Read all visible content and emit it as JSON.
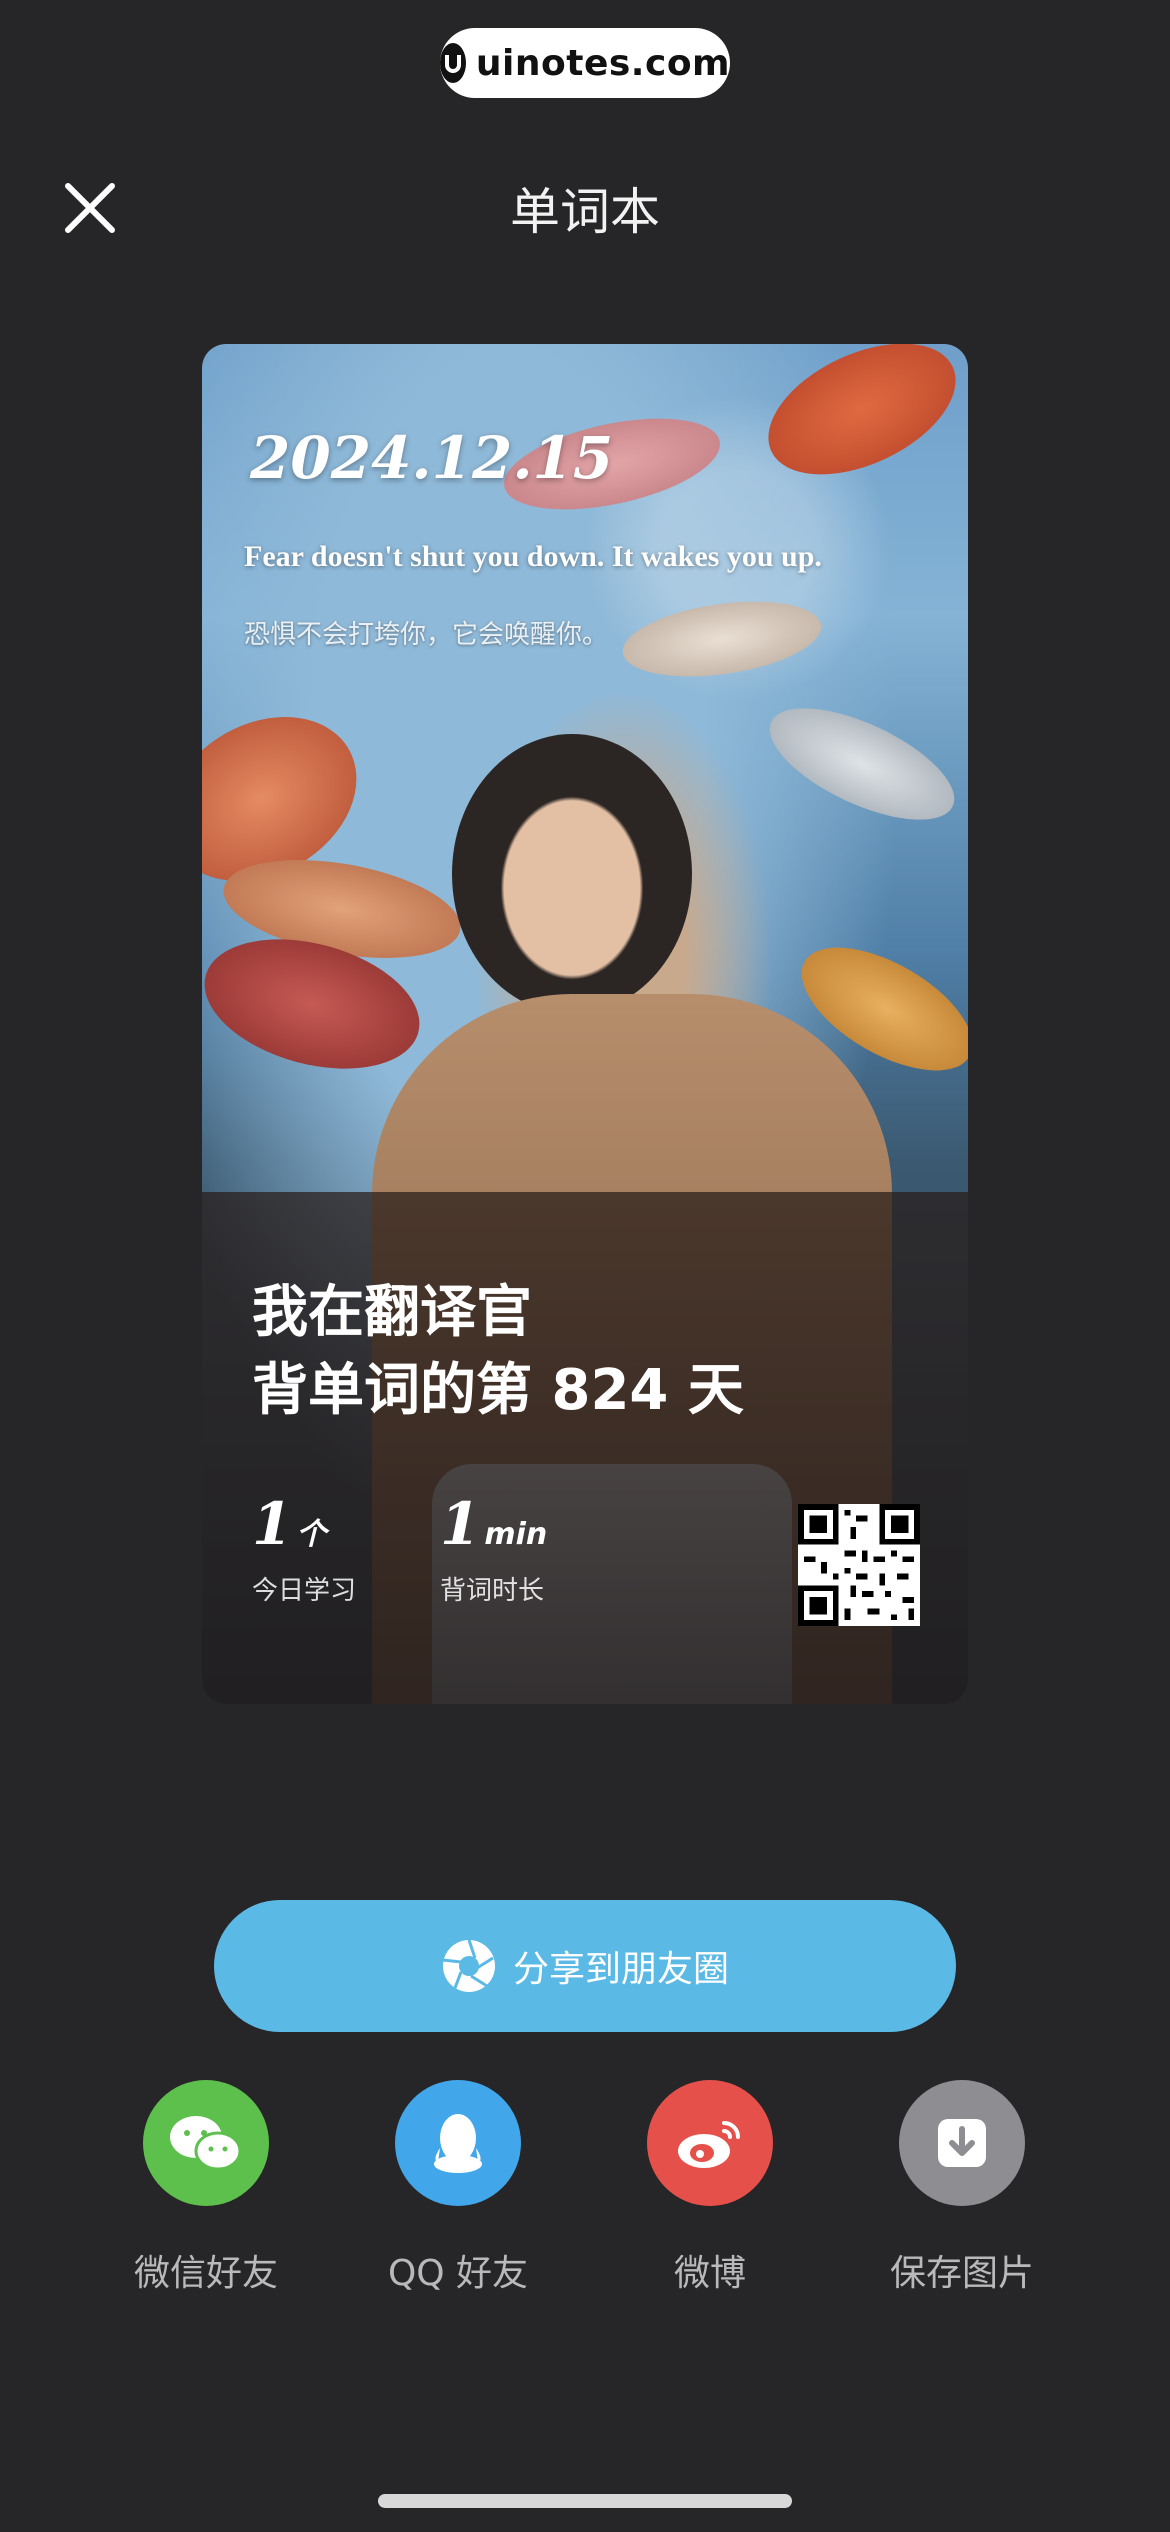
{
  "watermark": {
    "text": "uinotes.com"
  },
  "header": {
    "title": "单词本",
    "close_icon": "close-icon"
  },
  "card": {
    "date": "2024.12.15",
    "quote_en": "Fear doesn't shut you down. It wakes you up.",
    "quote_cn": "恐惧不会打垮你，它会唤醒你。",
    "headline_line1": "我在翻译官",
    "headline_line2": "背单词的第 824 天",
    "stats": [
      {
        "value": "1",
        "unit": "个",
        "label": "今日学习"
      },
      {
        "value": "1",
        "unit": "min",
        "label": "背词时长"
      }
    ]
  },
  "share": {
    "moments_label": "分享到朋友圈",
    "moments_color": "#5bb9e6"
  },
  "targets": [
    {
      "label": "微信好友",
      "icon": "wechat-icon",
      "color": "#5ec04c"
    },
    {
      "label": "QQ 好友",
      "icon": "qq-icon",
      "color": "#42a7ea"
    },
    {
      "label": "微博",
      "icon": "weibo-icon",
      "color": "#e5514a"
    },
    {
      "label": "保存图片",
      "icon": "download-icon",
      "color": "#8e8e92"
    }
  ]
}
